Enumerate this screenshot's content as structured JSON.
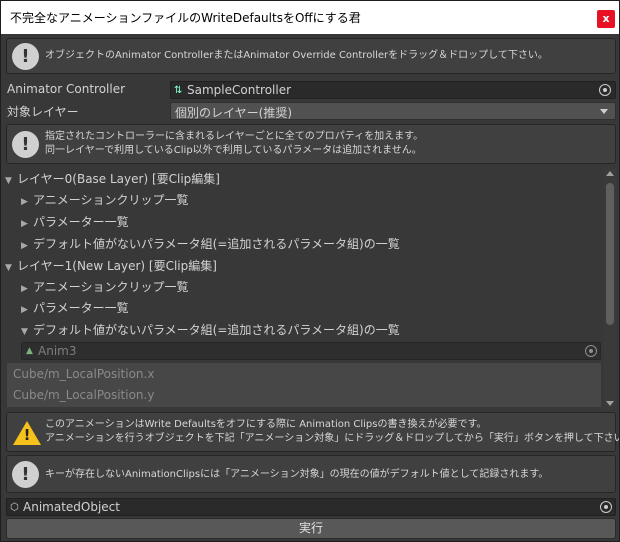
{
  "window": {
    "title": "不完全なアニメーションファイルのWriteDefaultsをOffにする君",
    "close_glyph": "x"
  },
  "help_top": {
    "message": "オブジェクトのAnimator ControllerまたはAnimator Override Controllerをドラッグ＆ドロップして下さい。"
  },
  "animator_controller": {
    "label": "Animator Controller",
    "value": "SampleController"
  },
  "target_layer": {
    "label": "対象レイヤー",
    "selected": "個別のレイヤー(推奨)"
  },
  "help_layer": {
    "line1": "指定されたコントローラーに含まれるレイヤーごとに全てのプロパティを加えます。",
    "line2": "同一レイヤーで利用しているClip以外で利用しているパラメータは追加されません。"
  },
  "layers": [
    {
      "label": "レイヤー0(Base Layer) [要Clip編集]",
      "expanded": true,
      "children": [
        {
          "label": "アニメーションクリップ一覧",
          "expanded": false
        },
        {
          "label": "パラメーター一覧",
          "expanded": false
        },
        {
          "label": "デフォルト値がないパラメータ組(=追加されるパラメータ組)の一覧",
          "expanded": false
        }
      ]
    },
    {
      "label": "レイヤー1(New Layer) [要Clip編集]",
      "expanded": true,
      "children": [
        {
          "label": "アニメーションクリップ一覧",
          "expanded": false
        },
        {
          "label": "パラメーター一覧",
          "expanded": false
        },
        {
          "label": "デフォルト値がないパラメータ組(=追加されるパラメータ組)の一覧",
          "expanded": true
        }
      ]
    }
  ],
  "anim_clip_field": {
    "value": "Anim3"
  },
  "param_list": [
    "Cube/m_LocalPosition.x",
    "Cube/m_LocalPosition.y"
  ],
  "warning": {
    "line1": "このアニメーションはWrite Defaultsをオフにする際に Animation Clipsの書き換えが必要です。",
    "line2": "アニメーションを行うオブジェクトを下記「アニメーション対象」にドラッグ＆ドロップしてから「実行」ボタンを押して下さい。"
  },
  "help_bottom": {
    "message": "キーが存在しないAnimationClipsには「アニメーション対象」の現在の値がデフォルト値として記録されます。"
  },
  "animated_object": {
    "value": "AnimatedObject"
  },
  "run_button": {
    "label": "実行"
  },
  "colors": {
    "background": "#383838",
    "title_bar": "#ffffff",
    "close_button": "#e81123",
    "warning_yellow": "#f4c21b"
  }
}
